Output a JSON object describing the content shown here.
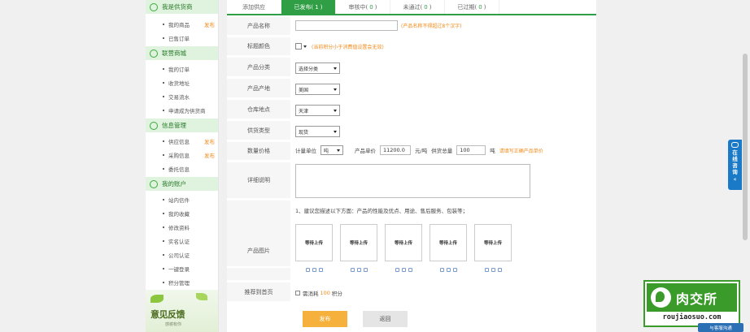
{
  "sidebar": {
    "sections": [
      {
        "title": "我是供货商",
        "items": [
          {
            "label": "我的商品",
            "tag": "发布"
          },
          {
            "label": "已售订单",
            "tag": ""
          }
        ]
      },
      {
        "title": "联营商城",
        "items": [
          {
            "label": "我的订单",
            "tag": ""
          },
          {
            "label": "收货地址",
            "tag": ""
          },
          {
            "label": "交易流水",
            "tag": ""
          },
          {
            "label": "申请成为供货商",
            "tag": ""
          }
        ]
      },
      {
        "title": "信息管理",
        "items": [
          {
            "label": "供应信息",
            "tag": "发布"
          },
          {
            "label": "采购信息",
            "tag": "发布"
          },
          {
            "label": "委托信息",
            "tag": ""
          }
        ]
      },
      {
        "title": "我的账户",
        "items": [
          {
            "label": "站内信件",
            "tag": ""
          },
          {
            "label": "我的收藏",
            "tag": ""
          },
          {
            "label": "修改资料",
            "tag": ""
          },
          {
            "label": "实名认证",
            "tag": ""
          },
          {
            "label": "公司认证",
            "tag": ""
          },
          {
            "label": "一键登录",
            "tag": ""
          },
          {
            "label": "积分管理",
            "tag": ""
          }
        ]
      }
    ],
    "banner": {
      "title": "意见反馈",
      "subtitle": "感谢有你"
    }
  },
  "tabs": [
    {
      "label": "添加供应",
      "count": ""
    },
    {
      "label": "已发布",
      "count": "1"
    },
    {
      "label": "审核中",
      "count": "0"
    },
    {
      "label": "未通过",
      "count": "0"
    },
    {
      "label": "已过期",
      "count": "0"
    }
  ],
  "active_tab": 1,
  "form": {
    "name": {
      "label": "产品名称",
      "value": "",
      "hint": "(产品名称不得超过8个汉字)"
    },
    "title_color": {
      "label": "标题颜色",
      "hint": "(当前积分小于消费值设置会无效)"
    },
    "category": {
      "label": "产品分类",
      "value": "选择分类"
    },
    "origin": {
      "label": "产品产地",
      "value": "美国"
    },
    "warehouse": {
      "label": "仓库地点",
      "value": "天津"
    },
    "supply_type": {
      "label": "供货类型",
      "value": "现货"
    },
    "qty_price": {
      "label": "数量价格",
      "unit_label": "计量单位",
      "unit_value": "吨",
      "price_label": "产品单价",
      "price_value": "11200.0",
      "price_unit": "元/吨",
      "total_label": "供货总量",
      "total_value": "100",
      "total_unit": "吨",
      "hint": "请填写正确产品单价"
    },
    "detail": {
      "label": "详细说明",
      "tip": "1、建议您描述以下方面：产品的性能及优点、用途、售后服务、包装等；"
    },
    "images": {
      "label": "产品图片",
      "slots": [
        "等待上传",
        "等待上传",
        "等待上传",
        "等待上传",
        "等待上传"
      ]
    },
    "recommend": {
      "label": "推荐到首页",
      "prefix": "需消耗",
      "points": "100",
      "suffix": "积分"
    }
  },
  "buttons": {
    "publish": "发布",
    "back": "返回"
  },
  "chat": {
    "text": "在线咨询",
    "glyph": "«"
  },
  "logo": {
    "title": "肉交所",
    "domain": "roujiaosuo.com"
  },
  "service_button": "与客服沟通"
}
